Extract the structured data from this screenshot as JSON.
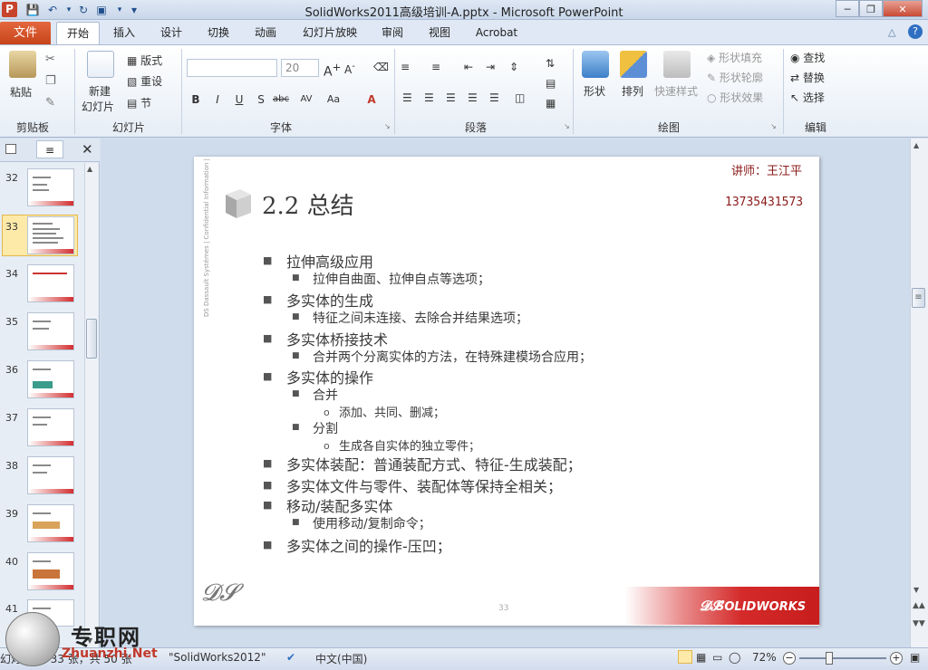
{
  "window": {
    "title": "SolidWorks2011高级培训-A.pptx  -  Microsoft PowerPoint",
    "app_icon": "P"
  },
  "qat": {
    "save_icon": "save-icon",
    "undo_icon": "undo-icon",
    "redo_icon": "redo-icon"
  },
  "tabs": {
    "file": "文件",
    "items": [
      "开始",
      "插入",
      "设计",
      "切换",
      "动画",
      "幻灯片放映",
      "审阅",
      "视图",
      "Acrobat"
    ]
  },
  "ribbon": {
    "clipboard": {
      "paste": "粘贴",
      "label": "剪贴板"
    },
    "slides": {
      "new_slide_1": "新建",
      "new_slide_2": "幻灯片",
      "layout": "版式",
      "reset": "重设",
      "section": "节",
      "label": "幻灯片"
    },
    "font": {
      "font_size": "20",
      "label": "字体"
    },
    "paragraph": {
      "label": "段落"
    },
    "drawing": {
      "shapes": "形状",
      "arrange": "排列",
      "quick_styles": "快速样式",
      "shape_fill": "形状填充",
      "shape_outline": "形状轮廓",
      "shape_effects": "形状效果",
      "label": "绘图"
    },
    "editing": {
      "find": "查找",
      "replace": "替换",
      "select": "选择",
      "label": "编辑"
    }
  },
  "thumbnails": [
    {
      "num": "32"
    },
    {
      "num": "33"
    },
    {
      "num": "34"
    },
    {
      "num": "35"
    },
    {
      "num": "36"
    },
    {
      "num": "37"
    },
    {
      "num": "38"
    },
    {
      "num": "39"
    },
    {
      "num": "40"
    },
    {
      "num": "41"
    }
  ],
  "slide": {
    "title": "2.2 总结",
    "lecturer": "讲师：王江平",
    "phone": "13735431573",
    "page": "33",
    "brand": "SOLIDWORKS",
    "side_text": "DS Dassault Systèmes | Confidential Information |",
    "bullets": [
      {
        "level": 1,
        "text": "拉伸高级应用"
      },
      {
        "level": 2,
        "text": "拉伸自曲面、拉伸自点等选项；"
      },
      {
        "level": 1,
        "text": "多实体的生成"
      },
      {
        "level": 2,
        "text": "特征之间未连接、去除合并结果选项；"
      },
      {
        "level": 1,
        "text": "多实体桥接技术"
      },
      {
        "level": 2,
        "text": "合并两个分离实体的方法，在特殊建模场合应用；"
      },
      {
        "level": 1,
        "text": "多实体的操作"
      },
      {
        "level": 2,
        "text": "合并"
      },
      {
        "level": 3,
        "text": "添加、共同、删减；"
      },
      {
        "level": 2,
        "text": "分割"
      },
      {
        "level": 3,
        "text": "生成各自实体的独立零件；"
      },
      {
        "level": 1,
        "text": "多实体装配：普通装配方式、特征-生成装配；"
      },
      {
        "level": 1,
        "text": "多实体文件与零件、装配体等保持全相关；"
      },
      {
        "level": 1,
        "text": "移动/装配多实体"
      },
      {
        "level": 2,
        "text": "使用移动/复制命令；"
      },
      {
        "level": 1,
        "text": "多实体之间的操作-压凹；"
      }
    ]
  },
  "status": {
    "slide_info": "幻灯片 第 33 张，共 50 张",
    "theme": "\"SolidWorks2012\"",
    "language": "中文(中国)",
    "zoom": "72%",
    "zoom_fraction": 0.72
  },
  "watermark": {
    "name": "专职网",
    "site": "Zhuanzhi.Net"
  },
  "colors": {
    "accent_red": "#c7441a",
    "title_red": "#8b1a1a",
    "brand_red": "#d42a2a"
  }
}
